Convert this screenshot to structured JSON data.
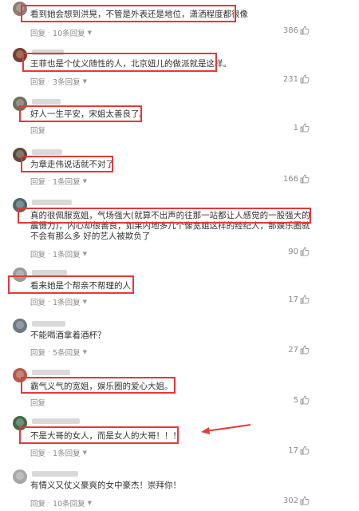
{
  "comments": [
    {
      "text": "看到她会想到洪晃，不管是外表还是地位，潇洒程度都很像",
      "reply": "回复",
      "thread": "10条回复",
      "likes": "386"
    },
    {
      "text": "王菲也是个仗义随性的人，北京妞儿的做派就是这样。",
      "reply": "回复",
      "thread": "3条回复",
      "likes": "231"
    },
    {
      "text": "好人一生平安，宋姐太善良了。",
      "reply": "回复",
      "thread": "",
      "likes": "1"
    },
    {
      "text": "为章走伟说话就不对了",
      "reply": "回复",
      "thread": "1条回复",
      "likes": "166"
    },
    {
      "text_line1": "真的很佩服宽姐，气场强大(就算不出声的往那一站都让人感觉的一股强大的震慑力)，内心却很善良，如果内地多几个像宽姐这样的经纪人，那娱乐圈就不会有那么多 好的艺人被欺负了",
      "reply": "回复",
      "thread": "1条回复",
      "likes": "90"
    },
    {
      "text": "看来她是个帮亲不帮理的人",
      "reply": "回复",
      "thread": "1条回复",
      "likes": "17"
    },
    {
      "text": "不能喝酒拿着酒杯？",
      "reply": "回复",
      "thread": "5条回复",
      "likes": "27"
    },
    {
      "text": "霸气义气的宽姐，娱乐圈的爱心大姐。",
      "reply": "回复",
      "thread": "",
      "likes": "5"
    },
    {
      "text": "不是大哥的女人，而是女人的大哥！！！",
      "reply": "回复",
      "thread": "1条回复",
      "likes": "17"
    },
    {
      "text": "有情义又仗义豪爽的女中豪杰！崇拜你！",
      "reply": "回复",
      "thread": "10条回复",
      "likes": "302"
    }
  ],
  "colors": {
    "highlight": "#e53935",
    "text": "#333333",
    "meta": "#8a8a8a"
  },
  "icons": {
    "like": "thumbs-up-icon",
    "expand": "triangle-down-icon",
    "annotation": "red-arrow"
  }
}
